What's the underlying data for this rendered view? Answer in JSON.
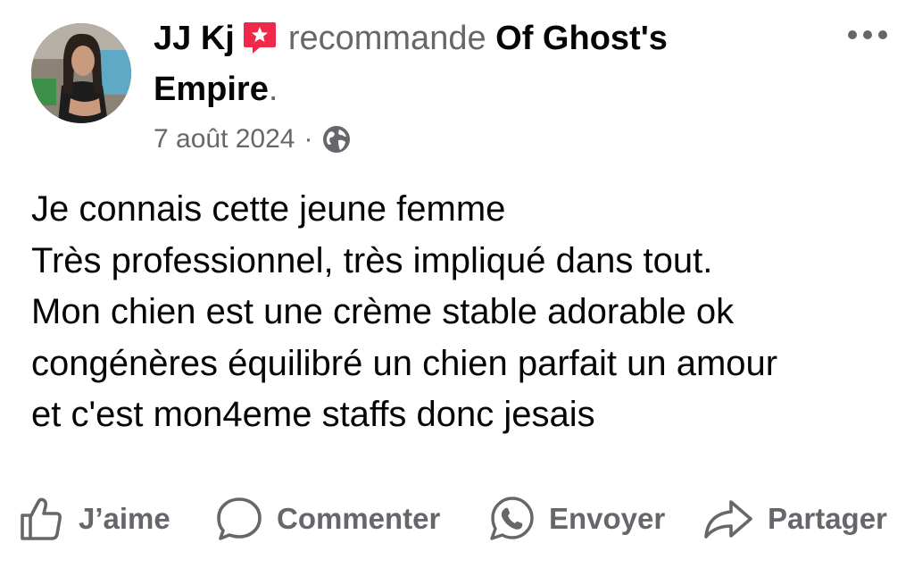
{
  "post": {
    "author_name": "JJ Kj",
    "recommend_text": "recommande",
    "page_name_line1": "Of Ghost's",
    "page_name_line2": "Empire",
    "period": ".",
    "date": "7 août 2024",
    "separator": "·",
    "privacy_icon": "globe-icon",
    "body_lines": [
      "Je connais cette jeune femme",
      "Très professionnel, très impliqué dans tout.",
      "Mon chien est une crème stable adorable ok",
      "congénères équilibré un chien parfait un amour",
      "et c'est mon4eme staffs donc jesais"
    ]
  },
  "badge": {
    "icon": "recommend-star-badge-icon",
    "color": "#f02849"
  },
  "more_menu_icon": "more-options-icon",
  "actions": {
    "like_label": "J’aime",
    "comment_label": "Commenter",
    "send_label": "Envoyer",
    "share_label": "Partager"
  },
  "colors": {
    "text_primary": "#050505",
    "text_secondary": "#65676b",
    "background": "#ffffff"
  }
}
